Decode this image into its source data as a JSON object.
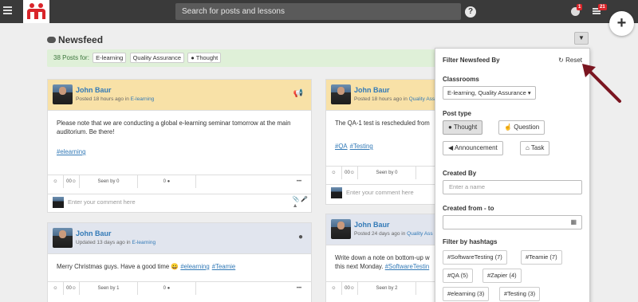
{
  "topbar": {
    "search_placeholder": "Search for posts and lessons",
    "help": "?",
    "notifications_count": "1",
    "tasks_count": "21",
    "add_button": "+"
  },
  "feed": {
    "title": "Newsfeed",
    "filter_icon": "filter-icon",
    "posts_summary": "38 Posts for:",
    "active_filters": [
      "E-learning",
      "Quality Assurance",
      "Thought"
    ]
  },
  "posts": [
    {
      "author": "John Baur",
      "meta_prefix": "Posted 18 hours ago in ",
      "category": "E-learning",
      "type_icon": "megaphone-icon",
      "text": "Please note that we are conducting a global e-learning seminar tomorrow at the main auditorium. Be there!",
      "tags": [
        "#elearning"
      ],
      "likes": "0",
      "stat2": "0",
      "seen": "Seen by 0",
      "comments": "0",
      "more": "•••",
      "comment_placeholder": "Enter your comment here"
    },
    {
      "author": "John Baur",
      "meta_prefix": "Updated 13 days ago in ",
      "category": "E-learning",
      "type_icon": "speech-bubble-icon",
      "text": "Merry Christmas guys. Have a good time 😀 ",
      "tags": [
        "#elearning",
        "#Teamie"
      ],
      "likes": "0",
      "stat2": "0",
      "seen": "Seen by 1",
      "comments": "0",
      "more": "•••"
    },
    {
      "author": "John Baur",
      "meta_prefix": "Posted 18 hours ago in ",
      "category": "Quality Ass",
      "text": "The QA-1 test is rescheduled from",
      "tags": [
        "#QA",
        "#Testing"
      ],
      "likes": "0",
      "stat2": "0",
      "seen": "Seen by 0",
      "comment_placeholder": "Enter your comment here"
    },
    {
      "author": "John Baur",
      "meta_prefix": "Posted 24 days ago in ",
      "category": "Quality Ass",
      "text_line1": "Write down a note on bottom-up w",
      "text_line2": "this next Monday. ",
      "text_tag": "#SoftwareTestin",
      "likes": "0",
      "stat2": "0",
      "seen": "Seen by 2"
    }
  ],
  "filter_panel": {
    "title": "Filter Newsfeed By",
    "reset": "Reset",
    "classrooms_label": "Classrooms",
    "classrooms_value": "E-learning, Quality Assurance",
    "post_type_label": "Post type",
    "post_types": [
      "Thought",
      "Question",
      "Announcement",
      "Task"
    ],
    "active_post_type": "Thought",
    "created_by_label": "Created By",
    "created_by_placeholder": "Enter a name",
    "created_range_label": "Created from - to",
    "hashtags_label": "Filter by hashtags",
    "hashtags": [
      "#SoftwareTesting (7)",
      "#Teamie (7)",
      "#QA (5)",
      "#Zapier (4)",
      "#elearning (3)",
      "#Testing (3)"
    ]
  },
  "colors": {
    "topbar": "#3a3a3a",
    "brand_red": "#d9252a",
    "announcement_header": "#f8e1a7",
    "thought_header": "#e1e5ee",
    "link": "#337ab7",
    "summary_bar": "#dff0d8",
    "arrow": "#7a1520"
  }
}
